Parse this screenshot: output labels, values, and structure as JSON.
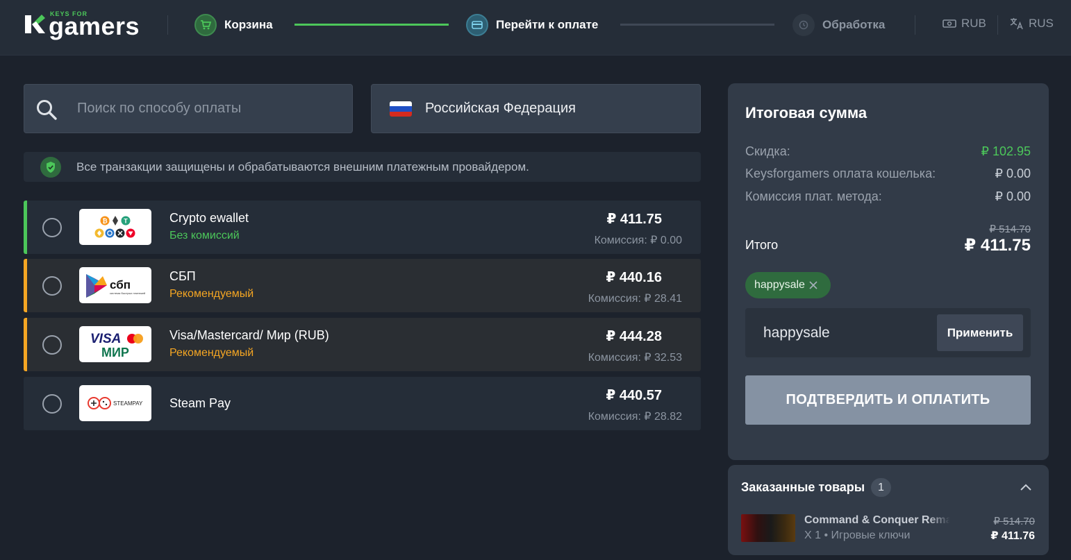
{
  "header": {
    "logo_small": "KEYS FOR",
    "logo_big": "gamers",
    "steps": [
      {
        "label": "Корзина",
        "state": "done"
      },
      {
        "label": "Перейти к оплате",
        "state": "active"
      },
      {
        "label": "Обработка",
        "state": "pending"
      }
    ],
    "currency": "RUB",
    "language": "RUS"
  },
  "search": {
    "placeholder": "Поиск по способу оплаты"
  },
  "country": {
    "name": "Российская Федерация"
  },
  "security_note": "Все транзакции защищены и обрабатываются внешним платежным провайдером.",
  "methods": [
    {
      "name": "Crypto ewallet",
      "sub": "Без комиссий",
      "price": "₽ 411.75",
      "fee": "Комиссия: ₽ 0.00",
      "accent": "#4cc75a",
      "sub_color": "#4cc75a",
      "logo": "crypto-logo"
    },
    {
      "name": "СБП",
      "sub": "Рекомендуемый",
      "price": "₽ 440.16",
      "fee": "Комиссия: ₽ 28.41",
      "accent": "#f5a623",
      "sub_color": "#f5a623",
      "logo": "sbp-logo",
      "logo_text": "сбп",
      "logo_caption": "система быстрых платежей"
    },
    {
      "name": "Visa/Mastercard/ Мир (RUB)",
      "sub": "Рекомендуемый",
      "price": "₽ 444.28",
      "fee": "Комиссия: ₽ 32.53",
      "accent": "#f5a623",
      "sub_color": "#f5a623",
      "logo": "visa-mir-logo",
      "logo_visa": "VISA",
      "logo_mir": "МИР"
    },
    {
      "name": "Steam Pay",
      "sub": "",
      "price": "₽ 440.57",
      "fee": "Комиссия: ₽ 28.82",
      "accent": "",
      "sub_color": "",
      "logo": "steampay-logo",
      "logo_text": "STEAMPAY"
    }
  ],
  "summary": {
    "title": "Итоговая сумма",
    "rows": [
      {
        "label": "Скидка:",
        "value": "₽ 102.95",
        "color": "#4cc75a"
      },
      {
        "label": "Keysforgamers оплата кошелька:",
        "value": "₽ 0.00",
        "color": "#c8ced6"
      },
      {
        "label": "Комиссия плат. метода:",
        "value": "₽ 0.00",
        "color": "#c8ced6"
      }
    ],
    "total_label": "Итого",
    "old_total": "₽ 514.70",
    "total": "₽ 411.75",
    "applied_code": "happysale",
    "promo_value": "happysale",
    "apply_label": "Применить",
    "confirm_label": "ПОДТВЕРДИТЬ И ОПЛАТИТЬ"
  },
  "ordered": {
    "title": "Заказанные товары",
    "count": "1",
    "items": [
      {
        "name": "Command & Conquer Remastered Collection",
        "meta": "X 1 • Игровые ключи",
        "old_price": "₽ 514.70",
        "price": "₽ 411.76"
      }
    ]
  },
  "colors": {
    "bg": "#1c222c",
    "panel": "#323b48",
    "green": "#4cc75a",
    "orange": "#f5a623",
    "confirm_disabled": "#8592a3"
  }
}
